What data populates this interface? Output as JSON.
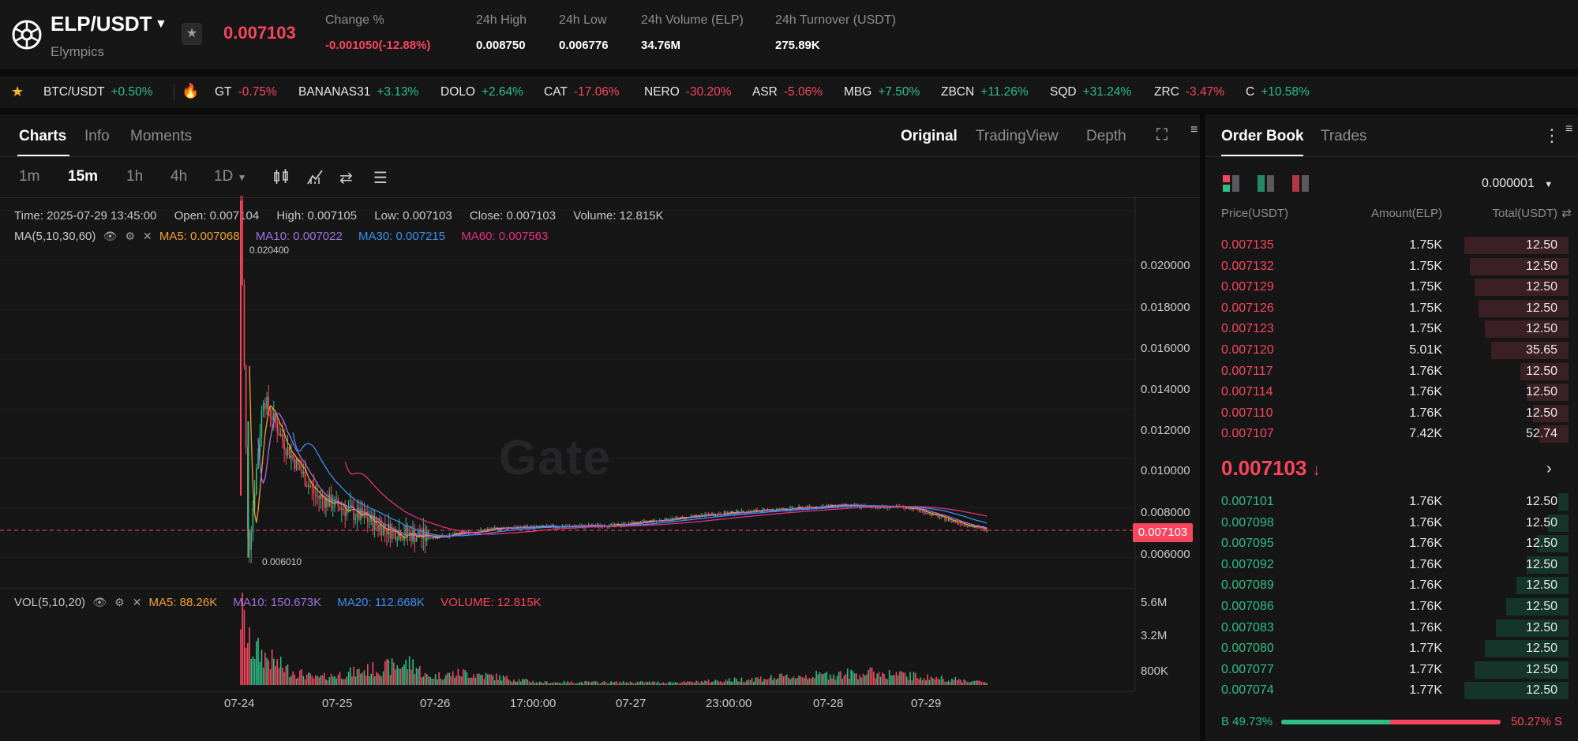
{
  "header": {
    "pair": "ELP/USDT",
    "pair_name": "Elympics",
    "last_price": "0.007103",
    "stats": [
      {
        "label": "Change %",
        "value": "-0.001050(-12.88%)",
        "color": "#f6465d"
      },
      {
        "label": "24h High",
        "value": "0.008750",
        "color": "#ffffff"
      },
      {
        "label": "24h Low",
        "value": "0.006776",
        "color": "#ffffff"
      },
      {
        "label": "24h Volume (ELP)",
        "value": "34.76M",
        "color": "#ffffff"
      },
      {
        "label": "24h Turnover (USDT)",
        "value": "275.89K",
        "color": "#ffffff"
      }
    ]
  },
  "ticker": [
    {
      "name": "BTC/USDT",
      "change": "+0.50%",
      "dir": "up"
    },
    {
      "name": "GT",
      "change": "-0.75%",
      "dir": "down"
    },
    {
      "name": "BANANAS31",
      "change": "+3.13%",
      "dir": "up"
    },
    {
      "name": "DOLO",
      "change": "+2.64%",
      "dir": "up"
    },
    {
      "name": "CAT",
      "change": "-17.06%",
      "dir": "down"
    },
    {
      "name": "NERO",
      "change": "-30.20%",
      "dir": "down"
    },
    {
      "name": "ASR",
      "change": "-5.06%",
      "dir": "down"
    },
    {
      "name": "MBG",
      "change": "+7.50%",
      "dir": "up"
    },
    {
      "name": "ZBCN",
      "change": "+11.26%",
      "dir": "up"
    },
    {
      "name": "SQD",
      "change": "+31.24%",
      "dir": "up"
    },
    {
      "name": "ZRC",
      "change": "-3.47%",
      "dir": "down"
    },
    {
      "name": "C",
      "change": "+10.58%",
      "dir": "up"
    }
  ],
  "chart_tabs": {
    "left": [
      "Charts",
      "Info",
      "Moments"
    ],
    "right": [
      "Original",
      "TradingView",
      "Depth"
    ]
  },
  "timeframes": [
    "1m",
    "15m",
    "1h",
    "4h",
    "1D"
  ],
  "ohlc": {
    "time": "Time: 2025-07-29 13:45:00",
    "open": "Open: 0.007104",
    "high": "High: 0.007105",
    "low": "Low: 0.007103",
    "close": "Close: 0.007103",
    "volume": "Volume: 12.815K"
  },
  "ma": {
    "label": "MA(5,10,30,60)",
    "ma5": "MA5: 0.007068",
    "ma10": "MA10: 0.007022",
    "ma30": "MA30: 0.007215",
    "ma60": "MA60: 0.007563"
  },
  "vol": {
    "label": "VOL(5,10,20)",
    "ma5": "MA5: 88.26K",
    "ma10": "MA10: 150.673K",
    "ma20": "MA20: 112.668K",
    "volume": "VOLUME: 12.815K"
  },
  "colors": {
    "up": "#2ebd85",
    "down": "#f6465d",
    "ma5": "#f0a030",
    "ma10": "#a070e0",
    "ma30": "#3a8ef0",
    "ma60": "#e0307a"
  },
  "chart_data": {
    "type": "candlestick",
    "price_axis": [
      "0.020000",
      "0.018000",
      "0.016000",
      "0.014000",
      "0.012000",
      "0.010000",
      "0.008000",
      "0.006000"
    ],
    "volume_axis": [
      "5.6M",
      "3.2M",
      "800K"
    ],
    "x_ticks": [
      "07-24",
      "07-25",
      "07-26",
      "17:00:00",
      "07-27",
      "23:00:00",
      "07-28",
      "07-29"
    ],
    "high_label": "0.020400",
    "low_label": "0.006010",
    "current_price": "0.007103",
    "ylim": [
      0.005,
      0.0206
    ],
    "price_path": [
      [
        0,
        0.0204
      ],
      [
        0.01,
        0.006
      ],
      [
        0.03,
        0.0125
      ],
      [
        0.06,
        0.0105
      ],
      [
        0.1,
        0.0085
      ],
      [
        0.15,
        0.0078
      ],
      [
        0.2,
        0.0071
      ],
      [
        0.25,
        0.0068
      ],
      [
        0.35,
        0.0072
      ],
      [
        0.5,
        0.0073
      ],
      [
        0.65,
        0.0078
      ],
      [
        0.8,
        0.0081
      ],
      [
        0.9,
        0.008
      ],
      [
        0.95,
        0.0075
      ],
      [
        1.0,
        0.0071
      ]
    ],
    "volume_path": [
      [
        0,
        5.6
      ],
      [
        0.01,
        3.0
      ],
      [
        0.03,
        2.2
      ],
      [
        0.06,
        1.2
      ],
      [
        0.1,
        0.5
      ],
      [
        0.23,
        1.6
      ],
      [
        0.25,
        0.6
      ],
      [
        0.3,
        0.9
      ],
      [
        0.4,
        0.2
      ],
      [
        0.6,
        0.2
      ],
      [
        0.8,
        0.8
      ],
      [
        0.85,
        0.9
      ],
      [
        1.0,
        0.2
      ]
    ]
  },
  "orderbook": {
    "tabs": [
      "Order Book",
      "Trades"
    ],
    "precision": "0.000001",
    "headers": {
      "price": "Price(USDT)",
      "amount": "Amount(ELP)",
      "total": "Total(USDT)"
    },
    "asks": [
      {
        "price": "0.007135",
        "amount": "1.75K",
        "total": "12.50",
        "depth": 1.0
      },
      {
        "price": "0.007132",
        "amount": "1.75K",
        "total": "12.50",
        "depth": 0.95
      },
      {
        "price": "0.007129",
        "amount": "1.75K",
        "total": "12.50",
        "depth": 0.9
      },
      {
        "price": "0.007126",
        "amount": "1.75K",
        "total": "12.50",
        "depth": 0.86
      },
      {
        "price": "0.007123",
        "amount": "1.75K",
        "total": "12.50",
        "depth": 0.8
      },
      {
        "price": "0.007120",
        "amount": "5.01K",
        "total": "35.65",
        "depth": 0.74
      },
      {
        "price": "0.007117",
        "amount": "1.76K",
        "total": "12.50",
        "depth": 0.46
      },
      {
        "price": "0.007114",
        "amount": "1.76K",
        "total": "12.50",
        "depth": 0.4
      },
      {
        "price": "0.007110",
        "amount": "1.76K",
        "total": "12.50",
        "depth": 0.34
      },
      {
        "price": "0.007107",
        "amount": "7.42K",
        "total": "52.74",
        "depth": 0.28
      }
    ],
    "mid_price": "0.007103",
    "bids": [
      {
        "price": "0.007101",
        "amount": "1.76K",
        "total": "12.50",
        "depth": 0.1
      },
      {
        "price": "0.007098",
        "amount": "1.76K",
        "total": "12.50",
        "depth": 0.2
      },
      {
        "price": "0.007095",
        "amount": "1.76K",
        "total": "12.50",
        "depth": 0.3
      },
      {
        "price": "0.007092",
        "amount": "1.76K",
        "total": "12.50",
        "depth": 0.4
      },
      {
        "price": "0.007089",
        "amount": "1.76K",
        "total": "12.50",
        "depth": 0.5
      },
      {
        "price": "0.007086",
        "amount": "1.76K",
        "total": "12.50",
        "depth": 0.6
      },
      {
        "price": "0.007083",
        "amount": "1.76K",
        "total": "12.50",
        "depth": 0.7
      },
      {
        "price": "0.007080",
        "amount": "1.77K",
        "total": "12.50",
        "depth": 0.8
      },
      {
        "price": "0.007077",
        "amount": "1.77K",
        "total": "12.50",
        "depth": 0.9
      },
      {
        "price": "0.007074",
        "amount": "1.77K",
        "total": "12.50",
        "depth": 1.0
      }
    ],
    "buy_ratio": "B 49.73%",
    "sell_ratio": "50.27% S",
    "buy_fraction": 0.4973
  }
}
